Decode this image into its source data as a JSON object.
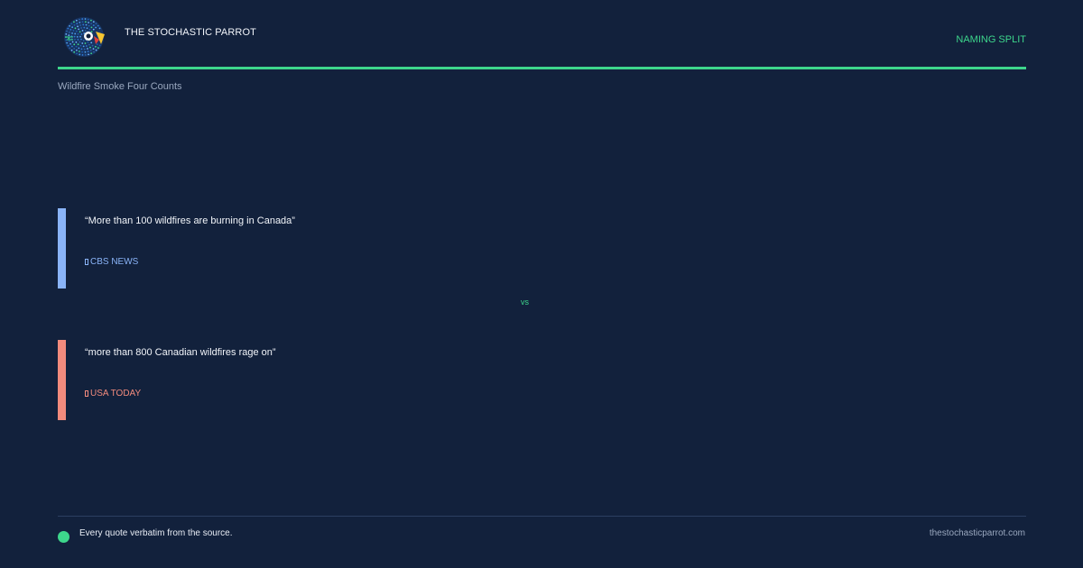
{
  "brand": {
    "name": "THE STOCHASTIC PARROT",
    "tag": "NAMING SPLIT",
    "accent": "#3dd68c"
  },
  "subtitle": "Wildfire Smoke Four Counts",
  "quotes": [
    {
      "text": "“More than 100 wildfires are burning in Canada”",
      "source": "CBS NEWS",
      "color": "#8ab4f8"
    },
    {
      "text": "“more than 800 Canadian wildfires rage on”",
      "source": "USA TODAY",
      "color": "#f28b7d"
    }
  ],
  "vs_label": "vs",
  "footer": {
    "note": "Every quote verbatim from the source.",
    "url": "thestochasticparrot.com",
    "dot_color": "#3dd68c"
  }
}
